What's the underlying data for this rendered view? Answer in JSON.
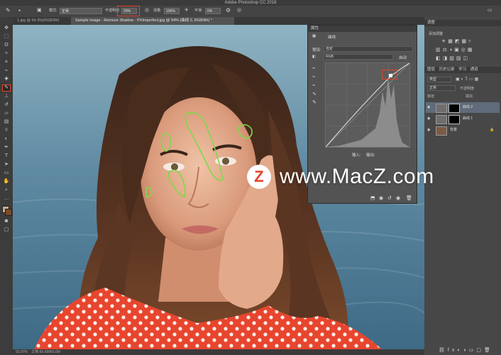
{
  "app": {
    "title": "Adobe Photoshop CC 2018"
  },
  "options_bar": {
    "mode_label": "模式:",
    "mode_value": "正常",
    "opacity_label": "不透明度:",
    "opacity_value": "20%",
    "flow_label": "流量:",
    "flow_value": "100%",
    "smooth_label": "平滑:",
    "smooth_value": "0%"
  },
  "tabs": [
    {
      "label": "1.jpg @ 64.9%(RGB/8#)"
    },
    {
      "label": "Sample Image - Remove Shadow - PXImperfect.jpg @ 94% (曲线 2, RGB/8#) *"
    }
  ],
  "properties": {
    "panel_title": "属性",
    "section_label": "曲线",
    "preset_label": "预设:",
    "preset_value": "自定",
    "channel_value": "RGB",
    "auto_label": "自动",
    "input_label": "输入:",
    "output_label": "输出:"
  },
  "right_dock": {
    "adjustments_tab": "调整",
    "add_adjustment_label": "添加调整",
    "layers_tabs": [
      "图层",
      "历史记录",
      "学习",
      "通道"
    ],
    "kind_label": "类型",
    "blend_value": "正常",
    "opacity_label": "不透明度:",
    "lock_label": "锁定:",
    "fill_label": "填充:",
    "layers": [
      {
        "name": "曲线 2",
        "selected": true
      },
      {
        "name": "曲线 1",
        "selected": false
      },
      {
        "name": "背景",
        "selected": false
      }
    ]
  },
  "status": {
    "zoom": "93.97%",
    "doc_info": "文档:65.6M/65.6M"
  },
  "watermark": {
    "logo_letter": "Z",
    "text": "www.MacZ.com"
  },
  "colors": {
    "accent_highlight": "#e8422b",
    "selection_stroke": "#7ed84a"
  }
}
